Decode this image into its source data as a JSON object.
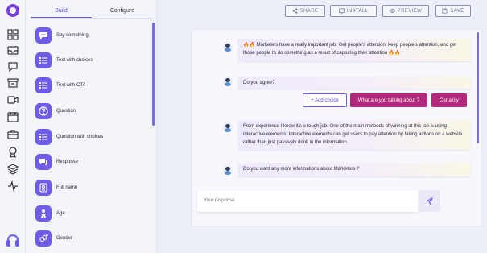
{
  "sidebar_tabs": [
    "Build",
    "Configure"
  ],
  "blocks": [
    {
      "label": "Say something",
      "icon": "speech-bubble-icon"
    },
    {
      "label": "Text with choices",
      "icon": "list-icon"
    },
    {
      "label": "Text with CTA",
      "icon": "list-icon"
    },
    {
      "label": "Question",
      "icon": "question-icon"
    },
    {
      "label": "Question with choices",
      "icon": "list-icon"
    },
    {
      "label": "Response",
      "icon": "chat-icon"
    },
    {
      "label": "Full name",
      "icon": "id-card-icon"
    },
    {
      "label": "Age",
      "icon": "baby-icon"
    },
    {
      "label": "Gender",
      "icon": "gender-icon"
    }
  ],
  "toolbar": {
    "share": "SHARE",
    "install": "INSTALL",
    "preview": "PREVIEW",
    "save": "SAVE"
  },
  "messages": {
    "m1": "🔥🔥 Marketers have a really important job: Get people's attention, keep people's attention, and get those people to do something as a result of capturing their attention 🔥🔥",
    "m2": "Do you agree?",
    "m3": "From experience I know it's a tough job. One of the main methods of winning at this job is using interactive elements. Interactive elements can get users to pay attention by taking actions on a website rather than just passively drink in the information.",
    "m4": "Do you want any more informations about Marketers ?"
  },
  "choices": {
    "add": "+ Add choice",
    "c1": "What are you talking about ?",
    "c2": "Certainly"
  },
  "response_placeholder": "Your response",
  "colors": {
    "accent": "#6c5ce7",
    "choice": "#b2287a",
    "logo": "#7b3fd9"
  }
}
